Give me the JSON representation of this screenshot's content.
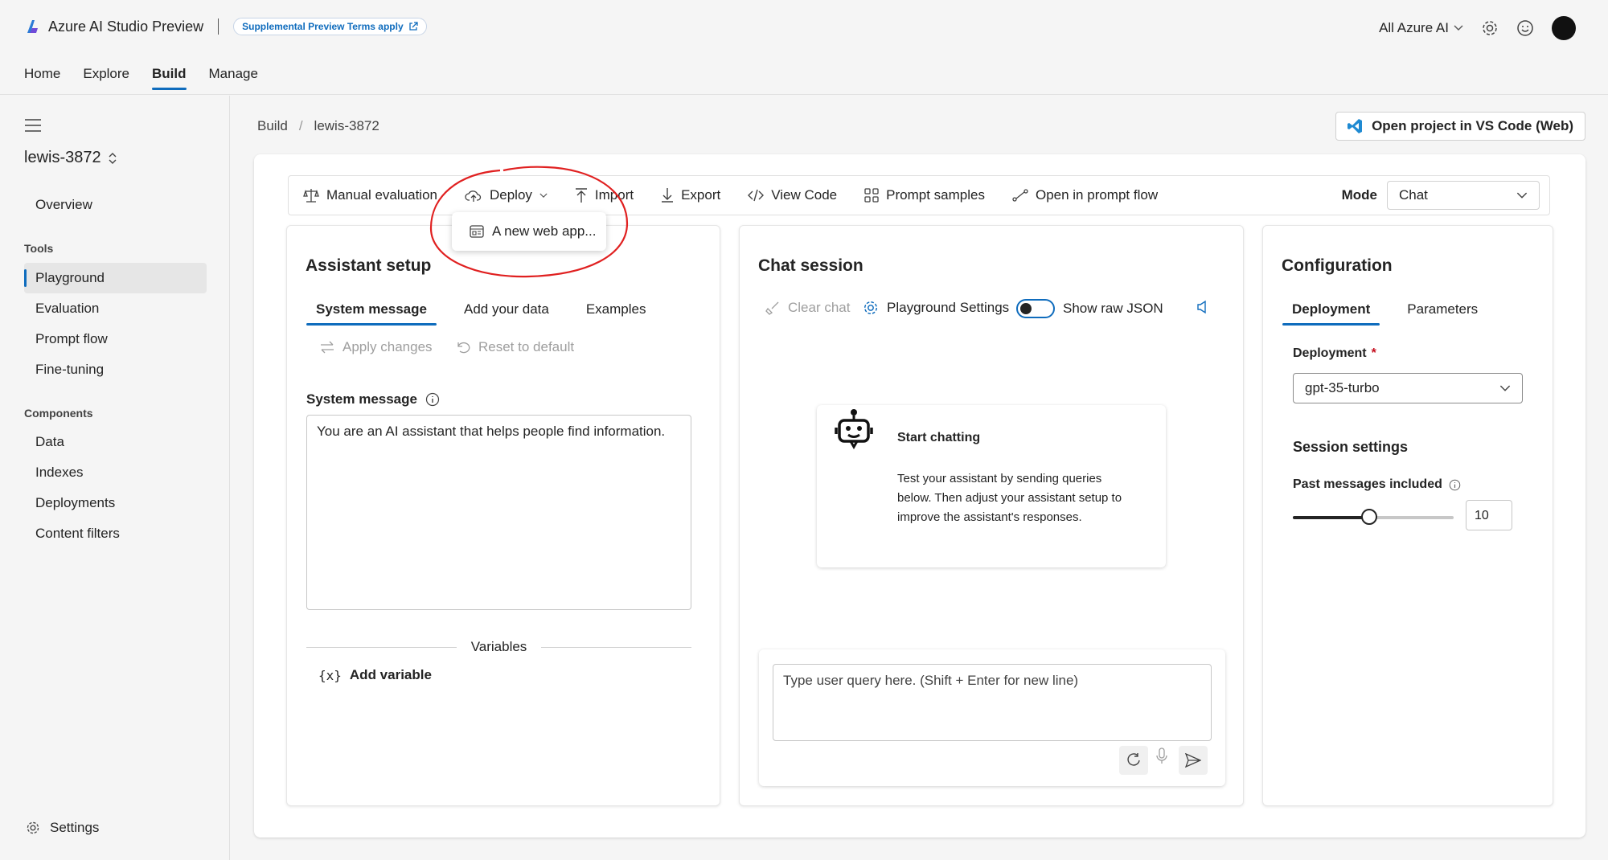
{
  "header": {
    "app_title": "Azure AI Studio Preview",
    "terms": "Supplemental Preview Terms apply",
    "scope": "All Azure AI"
  },
  "nav": {
    "tabs": [
      "Home",
      "Explore",
      "Build",
      "Manage"
    ]
  },
  "sidebar": {
    "project": "lewis-3872",
    "overview": "Overview",
    "tools_heading": "Tools",
    "tools": [
      "Playground",
      "Evaluation",
      "Prompt flow",
      "Fine-tuning"
    ],
    "components_heading": "Components",
    "components": [
      "Data",
      "Indexes",
      "Deployments",
      "Content filters"
    ],
    "settings": "Settings"
  },
  "breadcrumb": {
    "root": "Build",
    "sep": "/",
    "current": "lewis-3872"
  },
  "vscode_button": "Open project in VS Code (Web)",
  "toolbar": {
    "manual_eval": "Manual evaluation",
    "deploy": "Deploy",
    "import": "Import",
    "export": "Export",
    "view_code": "View Code",
    "prompt_samples": "Prompt samples",
    "open_prompt_flow": "Open in prompt flow",
    "mode_label": "Mode",
    "mode_value": "Chat"
  },
  "deploy_menu": {
    "item": "A new web app..."
  },
  "assistant": {
    "title": "Assistant setup",
    "tabs": [
      "System message",
      "Add your data",
      "Examples"
    ],
    "apply": "Apply changes",
    "reset": "Reset to default",
    "system_label": "System message",
    "system_value": "You are an AI assistant that helps people find information.",
    "variables": "Variables",
    "add_variable": "Add variable"
  },
  "chat": {
    "title": "Chat session",
    "clear": "Clear chat",
    "settings": "Playground Settings",
    "raw_json": "Show raw JSON",
    "start_title": "Start chatting",
    "start_body": "Test your assistant by sending queries below. Then adjust your assistant setup to improve the assistant's responses.",
    "placeholder": "Type user query here. (Shift + Enter for new line)"
  },
  "config": {
    "title": "Configuration",
    "tabs": [
      "Deployment",
      "Parameters"
    ],
    "deployment_label": "Deployment",
    "required": "*",
    "deployment_value": "gpt-35-turbo",
    "session_heading": "Session settings",
    "past_label": "Past messages included",
    "past_value": "10"
  },
  "colors": {
    "accent": "#0f6cbd",
    "annotation": "#e02020"
  }
}
